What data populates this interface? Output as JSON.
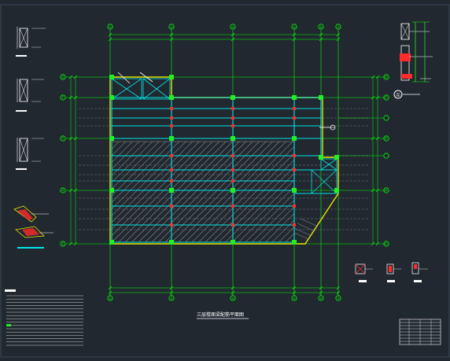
{
  "drawing": {
    "title": "三层楼面梁配筋平面图",
    "colors": {
      "background": "#212830",
      "frame": "#3a4a5a",
      "grid": "#00ff00",
      "beam": "#00e5e5",
      "wall": "#e5e500",
      "column": "#ff2a2a",
      "column_node": "#22ee22",
      "hatch": "#9a9a9a",
      "dim": "#ffffff",
      "dashed": "#b0b0b0"
    },
    "axis_labels_top": [
      "①",
      "③",
      "④",
      "⑤",
      "⑥",
      "⑦"
    ],
    "axis_labels_left": [
      "Ⓖ",
      "Ⓕ",
      "Ⓔ",
      "Ⓓ",
      "Ⓒ",
      "Ⓑ",
      "Ⓐ"
    ],
    "detail_marker": "①",
    "icons": [
      "column-section-icon",
      "detail-callout-icon",
      "section-cut-icon"
    ]
  }
}
